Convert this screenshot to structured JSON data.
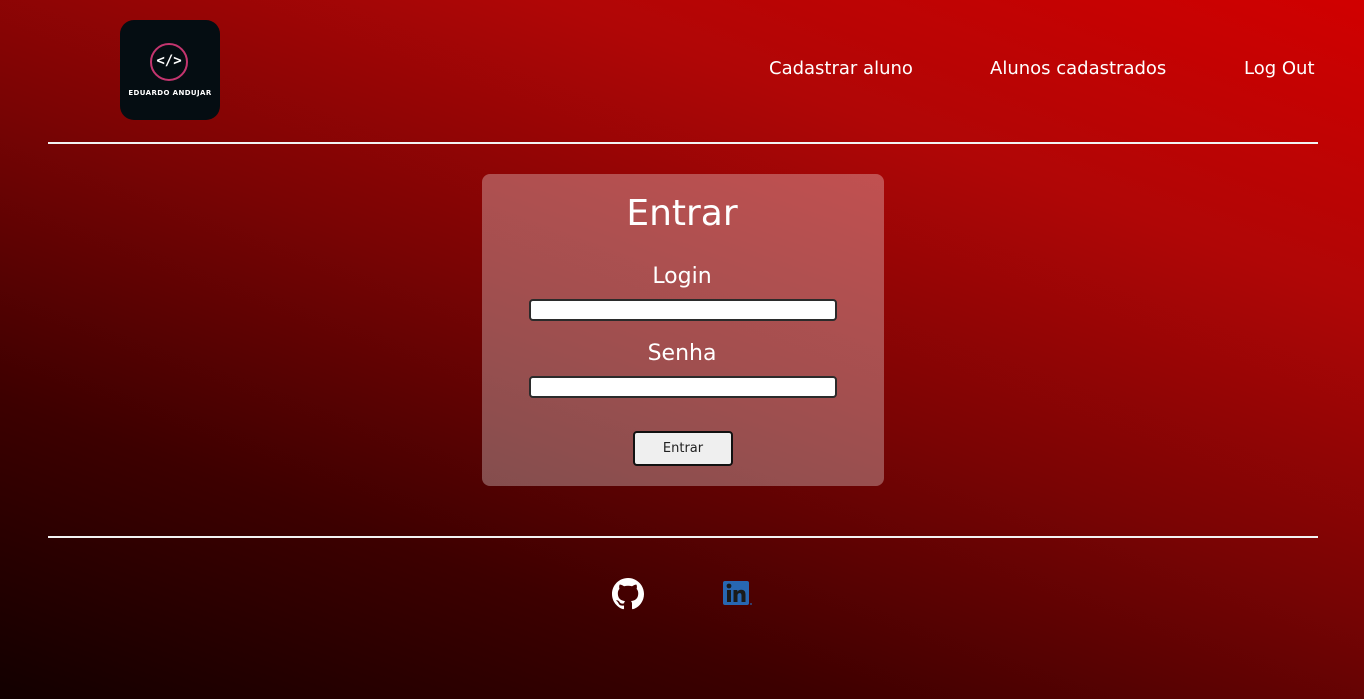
{
  "header": {
    "logo": {
      "symbol": "</>",
      "name": "EDUARDO ANDUJAR"
    },
    "nav": [
      {
        "label": "Cadastrar aluno"
      },
      {
        "label": "Alunos cadastrados"
      },
      {
        "label": "Log Out"
      }
    ]
  },
  "login_form": {
    "title": "Entrar",
    "login_label": "Login",
    "login_value": "",
    "senha_label": "Senha",
    "senha_value": "",
    "submit_label": "Entrar"
  },
  "footer": {
    "links": [
      {
        "icon": "github-icon"
      },
      {
        "icon": "linkedin-icon"
      }
    ]
  },
  "colors": {
    "background_top": "#d10000",
    "background_bottom": "#120000",
    "logo_accent": "#c4356f",
    "linkedin": "#2867b2"
  }
}
